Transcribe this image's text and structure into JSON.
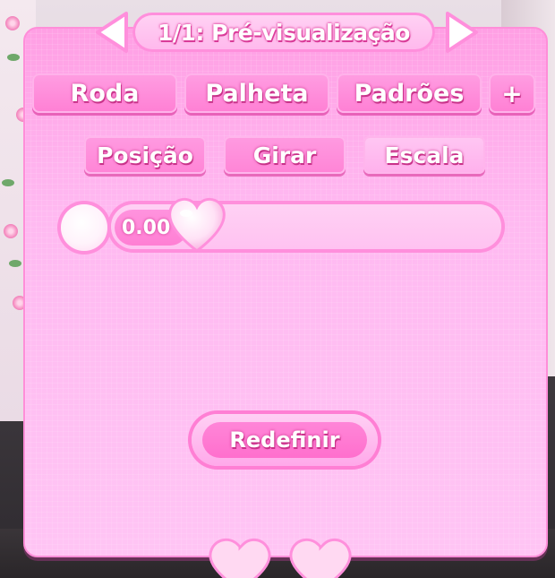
{
  "header": {
    "title": "1/1: Pré-visualização",
    "prev_icon": "triangle-left-icon",
    "next_icon": "triangle-right-icon"
  },
  "tabs": [
    {
      "label": "Roda"
    },
    {
      "label": "Palheta"
    },
    {
      "label": "Padrões"
    },
    {
      "label": "+"
    }
  ],
  "sub_tabs": [
    {
      "label": "Posição",
      "selected": false
    },
    {
      "label": "Girar",
      "selected": false
    },
    {
      "label": "Escala",
      "selected": true
    }
  ],
  "slider": {
    "value_text": "0.00",
    "value": 0,
    "thumb_icon": "heart-icon"
  },
  "reset": {
    "label": "Redefinir"
  },
  "colors": {
    "panel": "#ffb6f0",
    "accent": "#ff7fd4",
    "border": "#ff8fdc",
    "text": "#ffffff"
  }
}
